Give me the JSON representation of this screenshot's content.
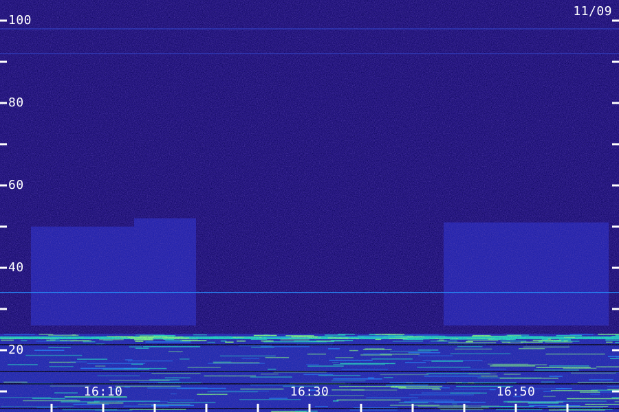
{
  "date_label": "11/09",
  "chart_data": {
    "type": "heatmap",
    "title": "",
    "xlabel": "",
    "ylabel": "",
    "ylim": [
      0,
      105
    ],
    "xlim": [
      "16:00",
      "16:59"
    ],
    "y_ticks_major": [
      20,
      40,
      60,
      80,
      100
    ],
    "y_tick_labels": [
      "20",
      "40",
      "60",
      "80",
      "100"
    ],
    "y_ticks_minor": [
      10,
      30,
      50,
      70,
      90
    ],
    "x_ticks_major": [
      "16:10",
      "16:30",
      "16:50"
    ],
    "x_tick_labels": [
      "16:10",
      "16:30",
      "16:50"
    ],
    "x_ticks_minor": [
      "16:05",
      "16:15",
      "16:20",
      "16:25",
      "16:35",
      "16:40",
      "16:45",
      "16:55"
    ],
    "colormap": [
      "#000000",
      "#2a1a7a",
      "#3030d0",
      "#1e90ff",
      "#20e0c0",
      "#80ff80"
    ],
    "background_level": "#1a0f4a",
    "bright_bands": [
      {
        "y": 23,
        "intensity": "high",
        "color": "#20e0c0"
      },
      {
        "y": 34,
        "intensity": "medium",
        "color": "#1e90ff"
      },
      {
        "y": 98,
        "intensity": "low",
        "color": "#3050e0"
      },
      {
        "y": 92,
        "intensity": "low",
        "color": "#3050e0"
      }
    ],
    "low_frequency_noise_below": 20,
    "active_blocks": [
      {
        "start": "16:03",
        "end": "16:13",
        "y_top": 50
      },
      {
        "start": "16:13",
        "end": "16:19",
        "y_top": 52
      },
      {
        "start": "16:43",
        "end": "16:59",
        "y_top": 51
      }
    ]
  }
}
